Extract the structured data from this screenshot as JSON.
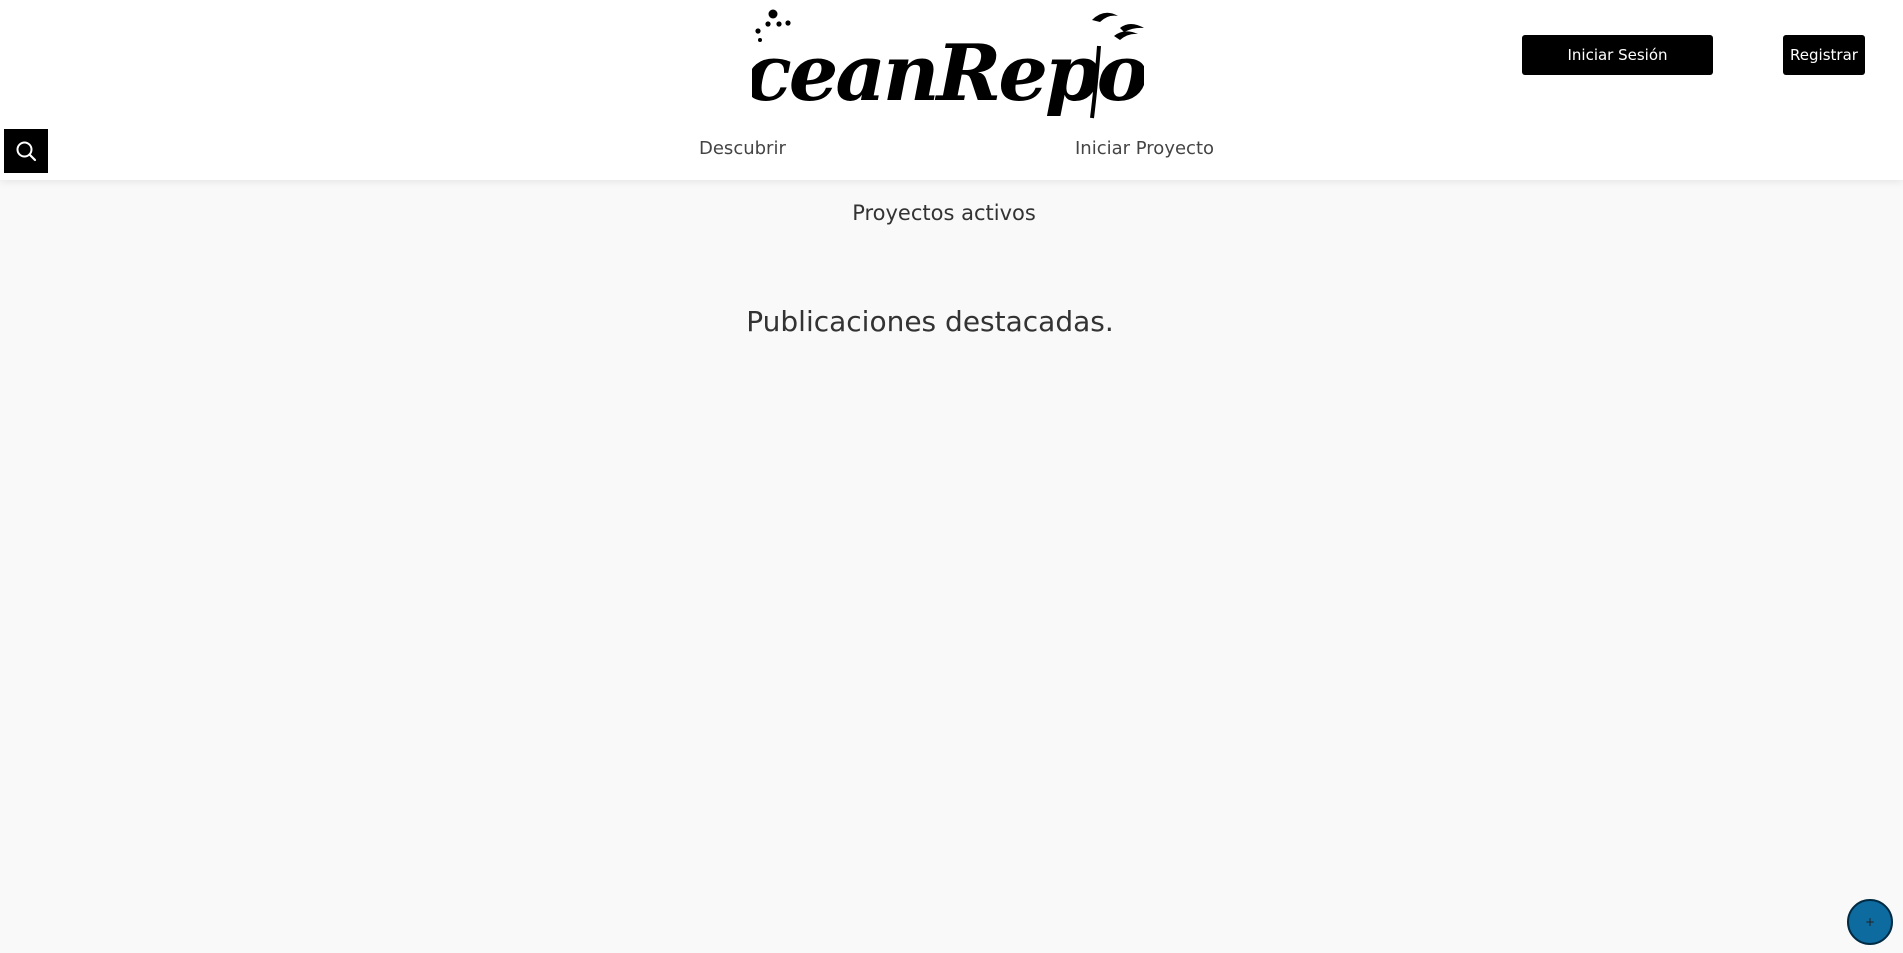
{
  "header": {
    "logo_text": "OceanReport",
    "login_label": "Iniciar Sesión",
    "register_label": "Registrar"
  },
  "nav": {
    "items": [
      {
        "label": "Descubrir"
      },
      {
        "label": "Iniciar Proyecto"
      }
    ],
    "search_icon": "search-icon"
  },
  "main": {
    "active_projects_title": "Proyectos activos",
    "featured_title": "Publicaciones destacadas."
  },
  "fab": {
    "label": "+",
    "color": "#0e6ba0"
  }
}
